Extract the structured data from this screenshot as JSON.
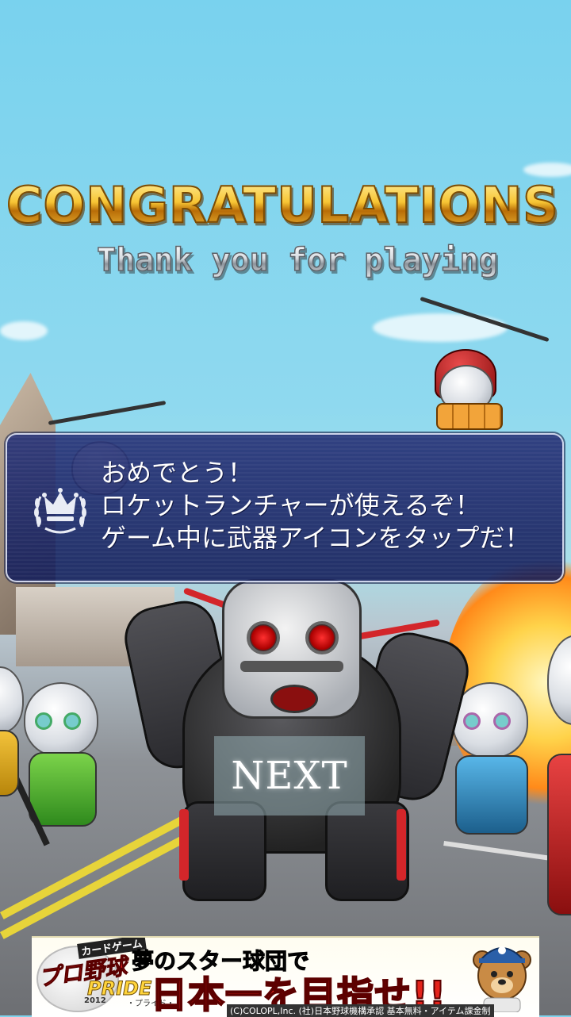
{
  "title": "CONGRATULATIONS",
  "subtitle": "Thank you for playing",
  "dialog": {
    "lines": [
      "おめでとう！",
      "ロケットランチャーが使えるぞ！",
      "ゲーム中に武器アイコンをタップだ！"
    ],
    "icon": "crown-laurel-icon"
  },
  "next_label": "NEXT",
  "ad": {
    "logo_top": "カードゲーム",
    "logo_main": "プロ野球",
    "logo_pride": "PRIDE",
    "logo_year": "2012",
    "logo_sub": "・プライド・",
    "headline_1": "夢のスター球団で",
    "headline_2": "日本一を目指せ!!",
    "footer": "(C)COLOPL,Inc. (社)日本野球機構承認 基本無料・アイテム課金制",
    "mascot": "bear-mascot-icon"
  },
  "colors": {
    "sky": "#79d2ee",
    "title_gold": "#f4b21c",
    "dialog_bg": "#23306f",
    "ad_red": "#e3231b"
  }
}
